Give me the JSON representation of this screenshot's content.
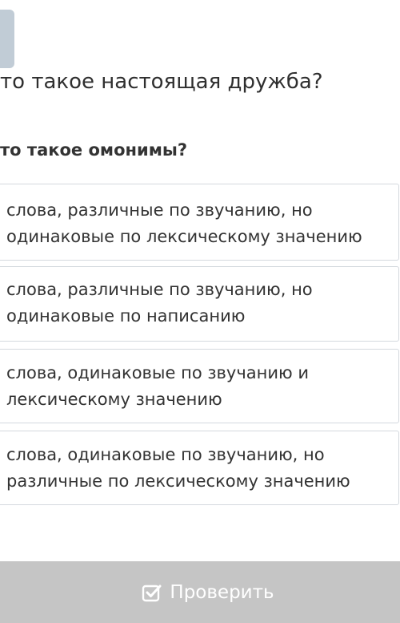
{
  "title": "то такое настоящая дружба?",
  "question": "то такое омонимы?",
  "options": [
    "слова, различные по звучанию, но\nодинаковые по лексическому значению",
    "слова, различные по звучанию, но\nодинаковые по написанию",
    "слова, одинаковые по звучанию и\nлексическому значению",
    "слова, одинаковые по звучанию, но\nразличные по лексическому значению"
  ],
  "footer": {
    "check_label": "Проверить",
    "check_icon": "checkbox-icon"
  },
  "colors": {
    "footer_bg": "#c5c5c5",
    "option_border": "#d4d9de",
    "tab": "#c1ccd6"
  }
}
